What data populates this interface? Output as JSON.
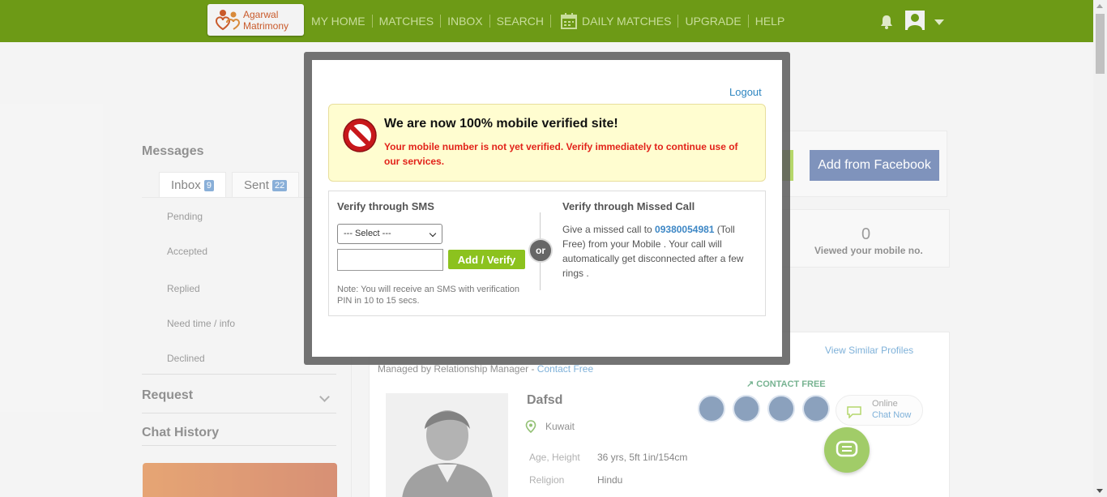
{
  "header": {
    "logo_line1": "Agarwal",
    "logo_line2": "Matrimony",
    "nav": [
      "MY HOME",
      "MATCHES",
      "INBOX",
      "SEARCH",
      "DAILY MATCHES",
      "UPGRADE",
      "HELP"
    ]
  },
  "sidebar": {
    "messages_title": "Messages",
    "tabs": [
      {
        "label": "Inbox",
        "count": "9"
      },
      {
        "label": "Sent",
        "count": "22"
      }
    ],
    "items": [
      "Pending",
      "Accepted",
      "Replied",
      "Need time / info",
      "Declined"
    ],
    "request_title": "Request",
    "chat_history_title": "Chat History"
  },
  "main": {
    "facebook_button": "Add from Facebook",
    "viewed_count": "0",
    "viewed_label": "Viewed your mobile no.",
    "view_similar": "View Similar Profiles",
    "managed_prefix": "Managed by Relationship Manager - ",
    "managed_link": "Contact Free",
    "contact_free": "CONTACT FREE",
    "online_label": "Online",
    "chat_now": "Chat Now",
    "profile": {
      "name": "Dafsd",
      "location": "Kuwait",
      "rows": [
        {
          "label": "Age, Height",
          "value": "36 yrs, 5ft 1in/154cm"
        },
        {
          "label": "Religion",
          "value": "Hindu"
        }
      ]
    }
  },
  "modal": {
    "logout": "Logout",
    "alert_title": "We are now 100% mobile verified site!",
    "alert_text": "Your mobile number is not yet verified. Verify immediately to continue use of our services.",
    "sms_title": "Verify through SMS",
    "select_value": "--- Select ---",
    "mobile_placeholder": "",
    "add_verify_label": "Add / Verify",
    "note": "Note: You will receive an SMS with verification PIN in 10 to 15 secs.",
    "or_label": "or",
    "missed_title": "Verify through Missed Call",
    "missed_prefix": "Give a missed call to ",
    "missed_number": "09380054981",
    "missed_suffix": " (Toll Free) from your Mobile . Your call will automatically get disconnected after a few rings ."
  },
  "colors": {
    "header_green": "#6d9a16",
    "button_green": "#8cc21e",
    "facebook_blue": "#3b5998",
    "alert_red": "#e2231a",
    "link_blue": "#2e86c1"
  }
}
